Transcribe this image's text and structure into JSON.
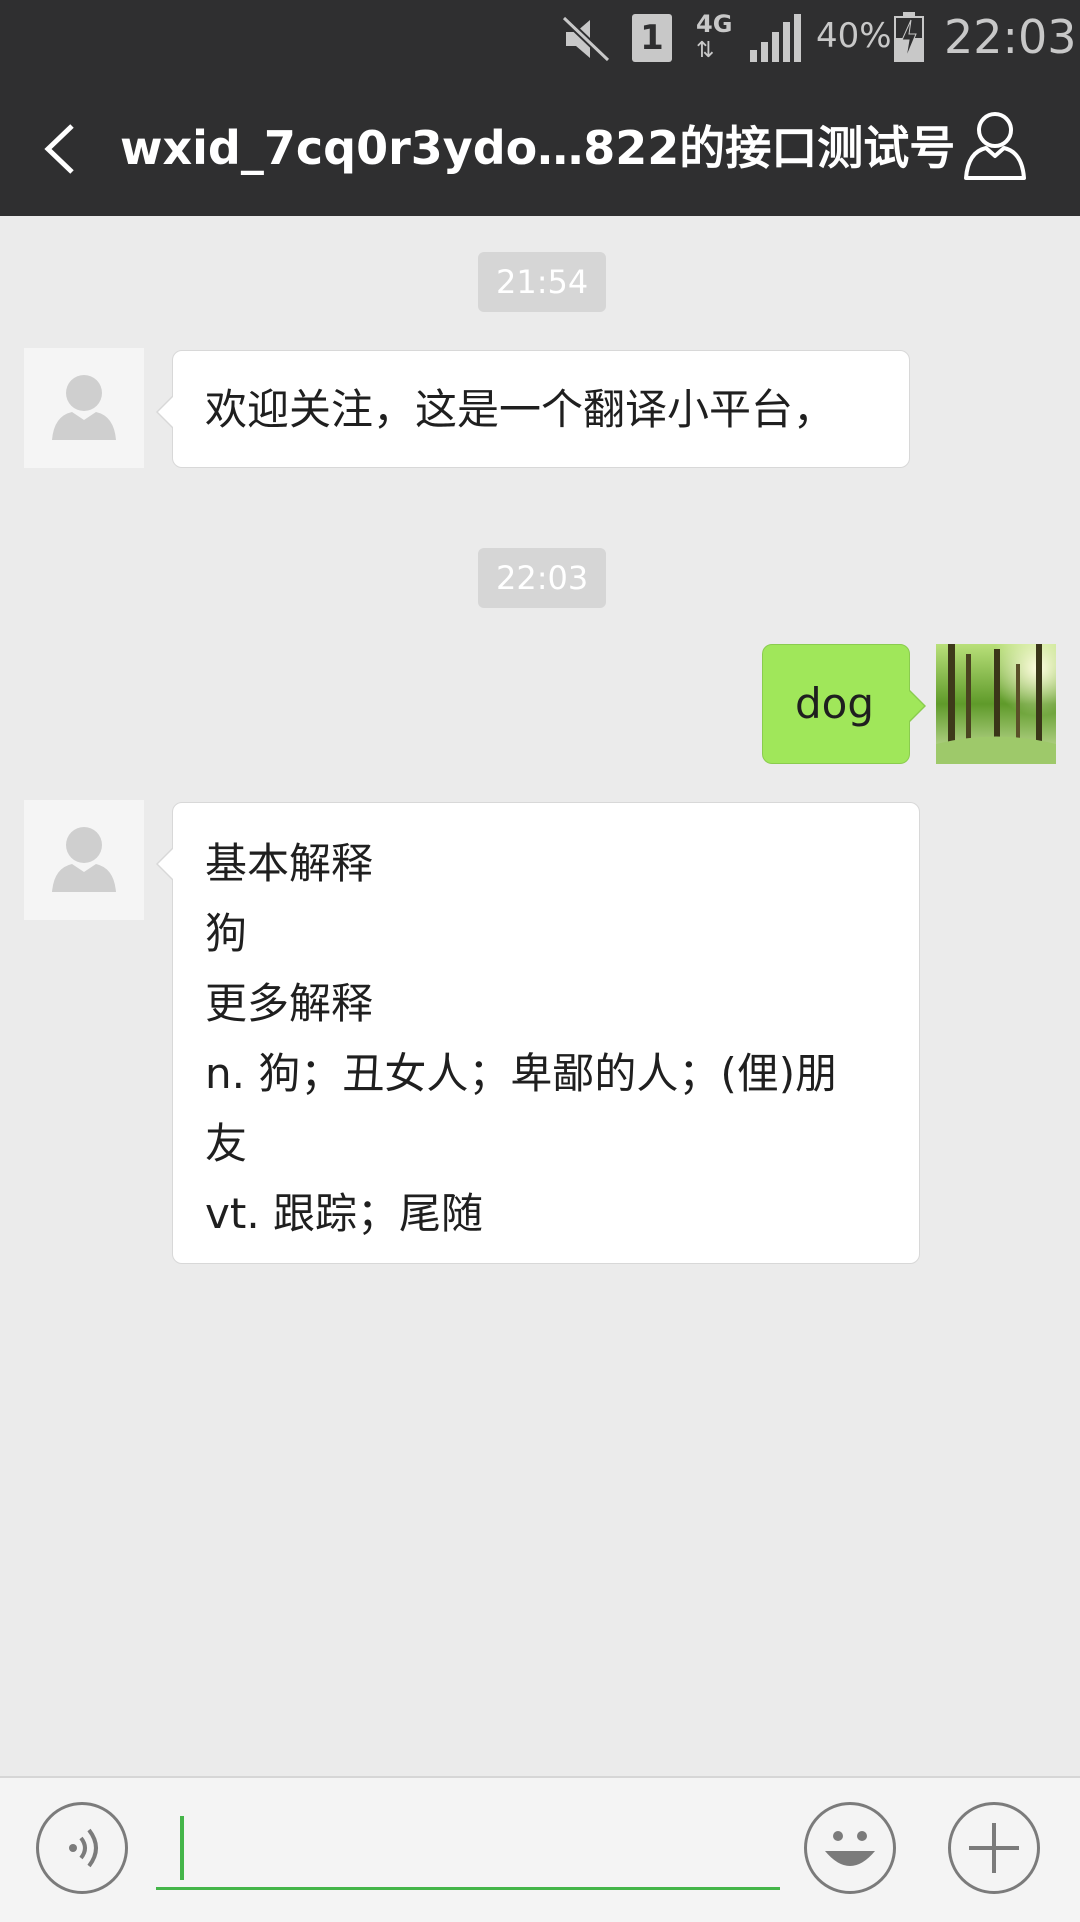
{
  "status_bar": {
    "sim_label": "1",
    "network": "4G",
    "battery": "40%",
    "time": "22:03",
    "icons": [
      "mute-icon",
      "sim-icon",
      "network-4g-icon",
      "signal-icon",
      "battery-charging-icon"
    ]
  },
  "header": {
    "title": "wxid_7cq0r3ydo…822的接口测试号",
    "back_icon": "chevron-left-icon",
    "profile_icon": "person-icon"
  },
  "messages": [
    {
      "type": "timestamp",
      "text": "21:54"
    },
    {
      "type": "incoming",
      "lines": [
        "欢迎关注，这是一个翻译小平台，"
      ]
    },
    {
      "type": "timestamp",
      "text": "22:03"
    },
    {
      "type": "outgoing",
      "lines": [
        "dog"
      ]
    },
    {
      "type": "incoming",
      "lines": [
        "基本解释",
        "狗",
        "更多解释",
        "n. 狗；丑女人；卑鄙的人；(俚)朋",
        "友",
        "vt. 跟踪；尾随"
      ]
    }
  ],
  "input_bar": {
    "value": "",
    "placeholder": "",
    "voice_icon": "voice-icon",
    "emoji_icon": "emoji-icon",
    "plus_icon": "plus-icon"
  },
  "colors": {
    "bar": "#2f2f30",
    "chat_bg": "#ebebeb",
    "outgoing_bubble": "#a0e75a",
    "accent": "#44b549"
  }
}
